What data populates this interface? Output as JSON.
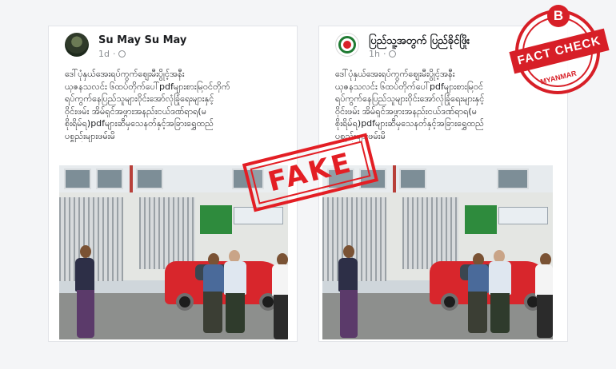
{
  "posts": [
    {
      "author": "Su May Su May",
      "time": "1d",
      "avatar": "profile-photo-soldier",
      "lines": [
        "ဒေါ်ပုံနှယ်အေးရပ်ကွက်ဈေးမီးပွိုင့်အနီး",
        "ယုဇနသလင်း ၆ထပ်တိုက်ပေါ်pdfများ‌စားမြဝင်တိုက်",
        "ရပ်ကွက်နေပြည်သူများဝိုင်းအော်လုံခြုံရေးများနှင့်",
        "ဝိုင်းဖမ်း အိမ်ရှင်အဖွားအနည်းငယ်ဒဏ်ရာရ(မ",
        "စိုးရိမ်ရ)pdfများဆီမှသေနတ်နှင့်အခြားရွှေထည်",
        "ပစ္စည်းများဖမ်းမိ"
      ]
    },
    {
      "author": "ပြည်သူ့အတွက် ပြည်ခိုင်ဖြိုး",
      "time": "1h",
      "avatar": "party-logo",
      "lines": [
        "ဒေါ်ပုံနှယ်အေးရပ်ကွက်ဈေးမီးပွိုင့်အနီး",
        "ယုဇနသလင်း ၆ထပ်တိုက်ပေါ်pdfများ‌စားမြဝင်",
        "ရပ်ကွက်နေပြည်သူများဝိုင်းအော်လုံခြုံရေးများနှင့်",
        "ဝိုင်းဖမ်း အိမ်ရှင်အဖွားအနည်းငယ်ဒဏ်ရာရ(မ",
        "စိုးရိမ်ရ)pdfများဆီမှသေနတ်နှင့်အခြားရွှေထည်",
        "ပစ္စည်းများဖမ်းမိ"
      ]
    }
  ],
  "stamp": {
    "text": "FAKE",
    "color": "#e31e24"
  },
  "badge": {
    "letter": "B",
    "label": "FACT CHECK",
    "country": "MYANMAR",
    "color": "#d71f27"
  }
}
